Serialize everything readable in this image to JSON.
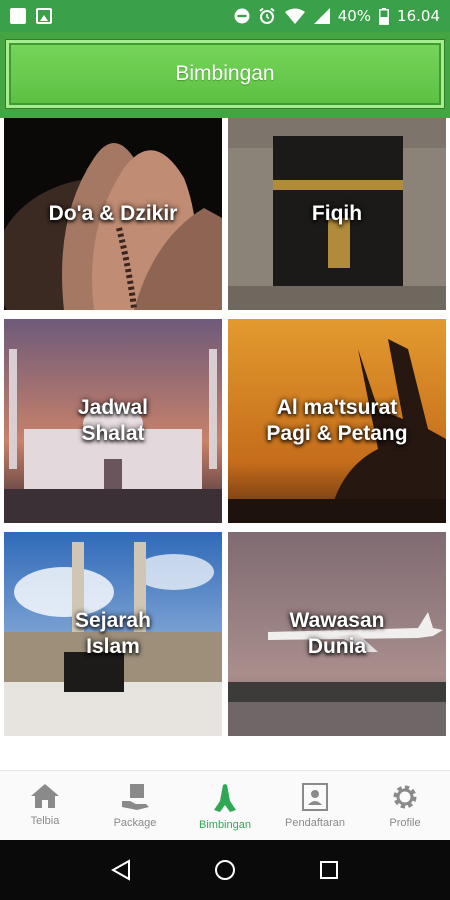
{
  "status_bar": {
    "battery": "40%",
    "time": "16.04"
  },
  "app_bar": {
    "title": "Bimbingan"
  },
  "tiles": [
    {
      "label": "Do'a & Dzikir",
      "image": "praying-hands"
    },
    {
      "label": "Fiqih",
      "image": "kaaba"
    },
    {
      "label": "Jadwal\nShalat",
      "image": "mosque-sunset"
    },
    {
      "label": "Al ma'tsurat\nPagi & Petang",
      "image": "prayer-silhouette"
    },
    {
      "label": "Sejarah\nIslam",
      "image": "masjid-haram"
    },
    {
      "label": "Wawasan\nDunia",
      "image": "airplane"
    }
  ],
  "bottom_nav": [
    {
      "label": "Telbia",
      "icon": "home-icon"
    },
    {
      "label": "Package",
      "icon": "package-icon"
    },
    {
      "label": "Bimbingan",
      "icon": "praying-hands-icon",
      "active": true
    },
    {
      "label": "Pendaftaran",
      "icon": "registration-icon"
    },
    {
      "label": "Profile",
      "icon": "gear-icon"
    }
  ],
  "colors": {
    "status_bar": "#3aa04a",
    "app_bar": "#44a542",
    "active_nav": "#2fa855"
  }
}
